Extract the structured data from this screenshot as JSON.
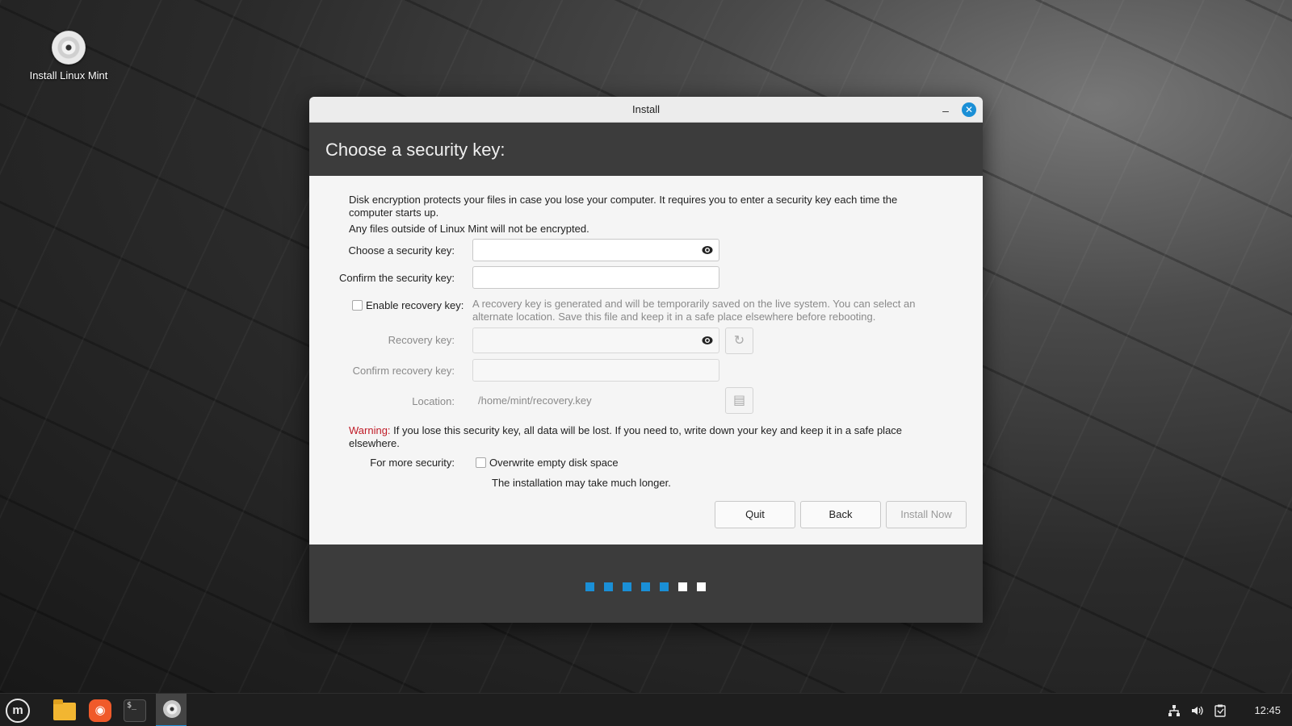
{
  "desktop": {
    "icon_label": "Install Linux Mint"
  },
  "window": {
    "title": "Install",
    "minimize_glyph": "–",
    "close_glyph": "✕",
    "header": "Choose a security key:"
  },
  "form": {
    "desc_line1": "Disk encryption protects your files in case you lose your computer. It requires you to enter a security key each time the computer starts up.",
    "desc_line2": "Any files outside of Linux Mint will not be encrypted.",
    "choose_key_label": "Choose a security key:",
    "choose_key_value": "",
    "confirm_key_label": "Confirm the security key:",
    "confirm_key_value": "",
    "recovery_checkbox_label": "Enable recovery key:",
    "recovery_checked": false,
    "recovery_desc": "A recovery key is generated and will be temporarily saved on the live system. You can select an alternate location. Save this file and keep it in a safe place elsewhere before rebooting.",
    "recovery_key_label": "Recovery key:",
    "confirm_recovery_label": "Confirm recovery key:",
    "location_label": "Location:",
    "location_value": "/home/mint/recovery.key",
    "warning_prefix": "Warning:",
    "warning_text": " If you lose this security key, all data will be lost. If you need to, write down your key and keep it in a safe place elsewhere.",
    "more_security_label": "For more security:",
    "overwrite_label": "Overwrite empty disk space",
    "overwrite_checked": false,
    "overwrite_note": "The installation may take much longer."
  },
  "buttons": {
    "quit": "Quit",
    "back": "Back",
    "install_now": "Install Now"
  },
  "progress": {
    "total_steps": 7,
    "completed_steps": 5,
    "active_color": "#1a8fd6",
    "inactive_color": "#ffffff"
  },
  "taskbar": {
    "clock": "12:45",
    "mint_glyph": "m",
    "terminal_glyph": "$_"
  },
  "colors": {
    "accent": "#1a8fd6",
    "warning": "#c01c28"
  }
}
